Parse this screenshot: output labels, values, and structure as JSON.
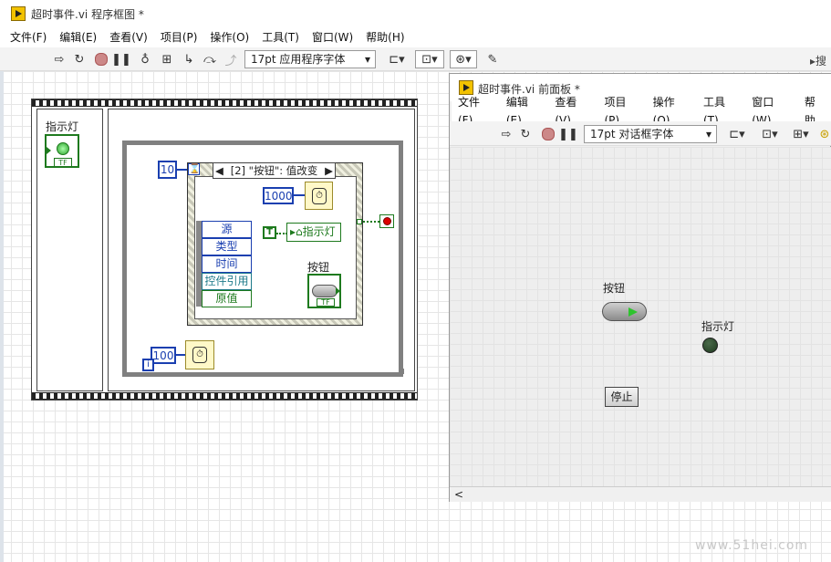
{
  "diagram_window": {
    "title": "超时事件.vi 程序框图 *",
    "menu": [
      "文件(F)",
      "编辑(E)",
      "查看(V)",
      "项目(P)",
      "操作(O)",
      "工具(T)",
      "窗口(W)",
      "帮助(H)"
    ],
    "font_selector": "17pt 应用程序字体",
    "right_text": "搜"
  },
  "block_diagram": {
    "indicator_label": "指示灯",
    "indicator_terminal": "TF",
    "timeout_constant": "10",
    "event_selector": "[2] \"按钮\": 值改变",
    "wait_constant": "1000",
    "event_data": [
      "源",
      "类型",
      "时间",
      "控件引用",
      "原值"
    ],
    "true_constant": "T",
    "property_node": "指示灯",
    "button_label": "按钮",
    "button_terminal": "TF",
    "loop_wait_constant": "100",
    "iteration_terminal": "i"
  },
  "panel_window": {
    "title": "超时事件.vi 前面板 *",
    "menu": [
      "文件(F)",
      "编辑(E)",
      "查看(V)",
      "项目(P)",
      "操作(O)",
      "工具(T)",
      "窗口(W)",
      "帮助"
    ],
    "font_selector": "17pt 对话框字体",
    "button_label": "按钮",
    "indicator_label": "指示灯",
    "stop_label": "停止",
    "scroll_left": "<"
  },
  "watermark": "www.51hei.com",
  "colors": {
    "wire_blue": "#1a3fb0",
    "bool_green": "#1e7a1e",
    "loop_gray": "#808080",
    "led_dark": "#1f3a1f"
  }
}
